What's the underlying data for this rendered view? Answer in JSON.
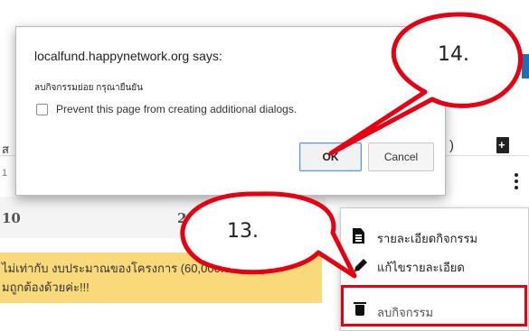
{
  "page": {
    "col_header_left": "ส",
    "row_left_fragment": "1",
    "header_right_paren": ")",
    "totals_left": "10",
    "totals_mid": "2,0",
    "warning_line1": "ไม่เท่ากับ งบประมาณของโครงการ (60,000.00 บาท)",
    "warning_line2": "มถูกต้องด้วยค่ะ!!!",
    "accent_color": "#1f6fb5",
    "warning_color": "#f9d97a"
  },
  "dialog": {
    "title": "localfund.happynetwork.org says:",
    "message": "ลบกิจกรรมย่อย กรุณายืนยัน",
    "checkbox_label": "Prevent this page from creating additional dialogs.",
    "checkbox_checked": false,
    "ok_label": "OK",
    "cancel_label": "Cancel"
  },
  "context_menu": {
    "items": [
      {
        "label": "รายละเอียดกิจกรรม",
        "icon": "document-icon"
      },
      {
        "label": "แก้ไขรายละเอียด",
        "icon": "pencil-icon"
      },
      {
        "label": "ลบกิจกรรม",
        "icon": "trash-icon"
      }
    ]
  },
  "annotations": {
    "callout_14": "14.",
    "callout_13": "13.",
    "highlight_color": "#e60012"
  }
}
